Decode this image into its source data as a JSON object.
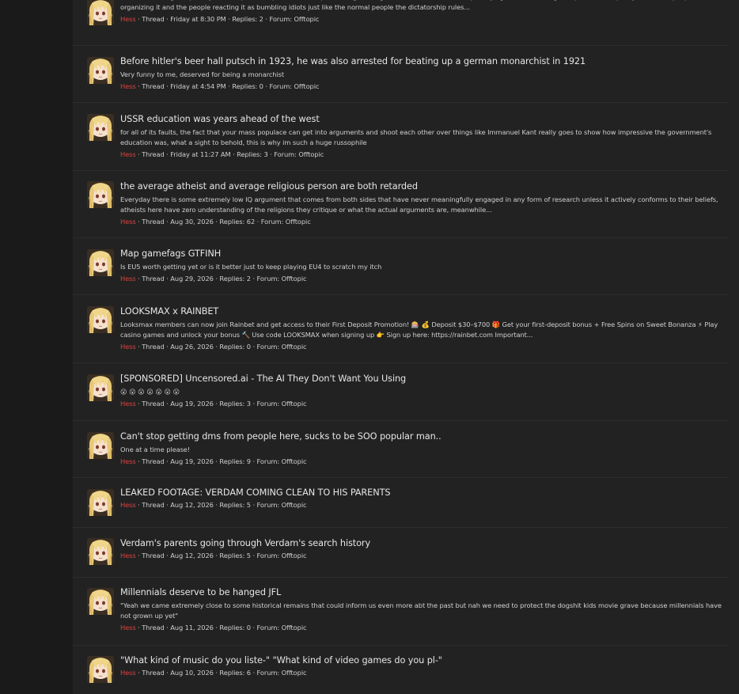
{
  "results": [
    {
      "title": "",
      "snippet": "This movie is a great portrayal of the political upheaval of the park-chung-hee regime and his assassination, portraying it not as some grand political conspiracy but as the people organizing it and the people reacting it as bumbling idiots just like the normal people the dictatorship rules...",
      "user": "Hess",
      "meta": " · Thread · Friday at 8:30 PM · Replies: 2 · Forum: ",
      "forum": "Offtopic"
    },
    {
      "title": "Before hitler's beer hall putsch in 1923, he was also arrested for beating up a german monarchist in 1921",
      "snippet": "Very funny to me, deserved for being a monarchist",
      "user": "Hess",
      "meta": " · Thread · Friday at 4:54 PM · Replies: 0 · Forum: ",
      "forum": "Offtopic"
    },
    {
      "title": "USSR education was years ahead of the west",
      "snippet": "for all of its faults, the fact that your mass populace can get into arguments and shoot each other over things like Immanuel Kant really goes to show how impressive the government's education was, what a sight to behold, this is why im such a huge russophile",
      "user": "Hess",
      "meta": " · Thread · Friday at 11:27 AM · Replies: 3 · Forum: ",
      "forum": "Offtopic"
    },
    {
      "title": "the average atheist and average religious person are both retarded",
      "snippet": "Everyday there is some extremely low IQ argument that comes from both sides that have never meaningfully engaged in any form of research unless it actively conforms to their beliefs, atheists here have zero understanding of the religions they critique or what the actual arguments are, meanwhile...",
      "user": "Hess",
      "meta": " · Thread · Aug 30, 2026 · Replies: 62 · Forum: ",
      "forum": "Offtopic"
    },
    {
      "title": "Map gamefags GTFINH",
      "snippet": "Is EU5 worth getting yet or is it better just to keep playing EU4 to scratch my itch",
      "user": "Hess",
      "meta": " · Thread · Aug 29, 2026 · Replies: 2 · Forum: ",
      "forum": "Offtopic"
    },
    {
      "title": "LOOKSMAX x RAINBET",
      "snippet": "Looksmax members can now join Rainbet and get access to their First Deposit Promotion! 🎰 💰 Deposit $30–$700 🎁 Get your first-deposit bonus + Free Spins on Sweet Bonanza ⚡ Play casino games and unlock your bonus 🔨 Use code LOOKSMAX when signing up 👉 Sign up here: https://rainbet.com Important...",
      "user": "Hess",
      "meta": " · Thread · Aug 26, 2026 · Replies: 0 · Forum: ",
      "forum": "Offtopic"
    },
    {
      "title": "[SPONSORED] Uncensored.ai - The AI They Don't Want You Using",
      "snippet": "😮 😮 😮 😮 😮 😮 😮",
      "user": "Hess",
      "meta": " · Thread · Aug 19, 2026 · Replies: 3 · Forum: ",
      "forum": "Offtopic"
    },
    {
      "title": "Can't stop getting dms from people here, sucks to be SOO popular man..",
      "snippet": "One at a time please!",
      "user": "Hess",
      "meta": " · Thread · Aug 19, 2026 · Replies: 9 · Forum: ",
      "forum": "Offtopic"
    },
    {
      "title": "LEAKED FOOTAGE: VERDAM COMING CLEAN TO HIS PARENTS",
      "snippet": "",
      "user": "Hess",
      "meta": " · Thread · Aug 12, 2026 · Replies: 5 · Forum: ",
      "forum": "Offtopic"
    },
    {
      "title": "Verdam's parents going through Verdam's search history",
      "snippet": "",
      "user": "Hess",
      "meta": " · Thread · Aug 12, 2026 · Replies: 5 · Forum: ",
      "forum": "Offtopic"
    },
    {
      "title": "Millennials deserve to be hanged JFL",
      "snippet": "\"Yeah we came extremely close to some historical remains that could inform us even more abt the past but nah we need to protect the dogshit kids movie grave because millennials have not grown up yet\"",
      "user": "Hess",
      "meta": " · Thread · Aug 11, 2026 · Replies: 0 · Forum: ",
      "forum": "Offtopic"
    },
    {
      "title": "\"What kind of music do you liste-\" \"What kind of video games do you pl-\"",
      "snippet": "",
      "user": "Hess",
      "meta": " · Thread · Aug 10, 2026 · Replies: 6 · Forum: ",
      "forum": "Offtopic"
    }
  ],
  "colors": {
    "page_background": "#1a1a1a",
    "panel_background": "#222222",
    "username": "#e0403f",
    "title_text": "#e6e6e6"
  },
  "icons": {
    "avatar": "anime-avatar-icon"
  }
}
